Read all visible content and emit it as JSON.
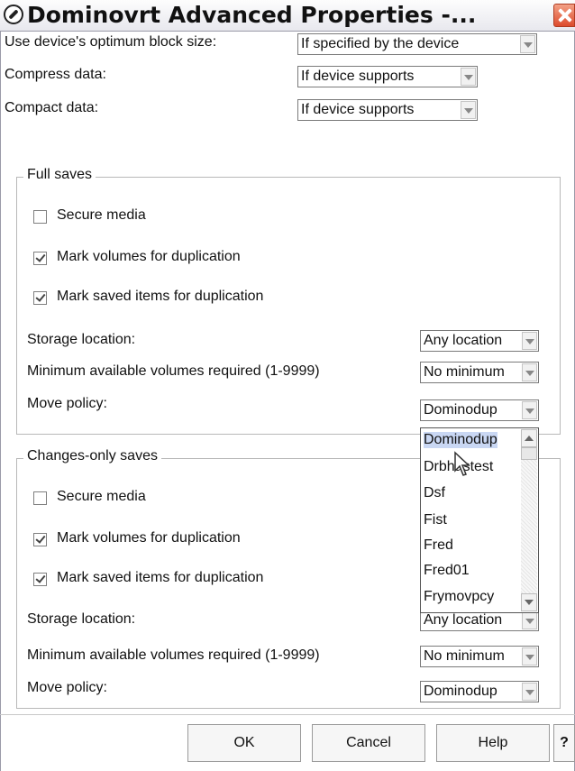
{
  "window": {
    "title": "Dominovrt Advanced Properties -..."
  },
  "top": {
    "block_size_label": "Use device's optimum block size:",
    "block_size_value": "If specified by the device",
    "compress_label": "Compress data:",
    "compress_value": "If device supports",
    "compact_label": "Compact data:",
    "compact_value": "If device supports"
  },
  "full_saves": {
    "legend": "Full saves",
    "secure_media": {
      "label": "Secure media",
      "checked": false
    },
    "mark_volumes": {
      "label": "Mark volumes for duplication",
      "checked": true
    },
    "mark_items": {
      "label": "Mark saved items for duplication",
      "checked": true
    },
    "storage_label": "Storage location:",
    "storage_value": "Any location",
    "min_volumes_label": "Minimum available volumes required (1-9999)",
    "min_volumes_value": "No minimum",
    "move_policy_label": "Move policy:",
    "move_policy_value": "Dominodup"
  },
  "move_policy_dropdown": {
    "options": [
      "Dominodup",
      "Drbhastest",
      "Dsf",
      "Fist",
      "Fred",
      "Fred01",
      "Frymovpcy"
    ],
    "highlighted": "Dominodup"
  },
  "changes_saves": {
    "legend": "Changes-only saves",
    "secure_media": {
      "label": "Secure media",
      "checked": false
    },
    "mark_volumes": {
      "label": "Mark volumes for duplication",
      "checked": true
    },
    "mark_items": {
      "label": "Mark saved items for duplication",
      "checked": true
    },
    "storage_label": "Storage location:",
    "storage_value": "Any location",
    "min_volumes_label": "Minimum available volumes required (1-9999)",
    "min_volumes_value": "No minimum",
    "move_policy_label": "Move policy:",
    "move_policy_value": "Dominodup"
  },
  "buttons": {
    "ok": "OK",
    "cancel": "Cancel",
    "help": "Help",
    "question": "?"
  }
}
